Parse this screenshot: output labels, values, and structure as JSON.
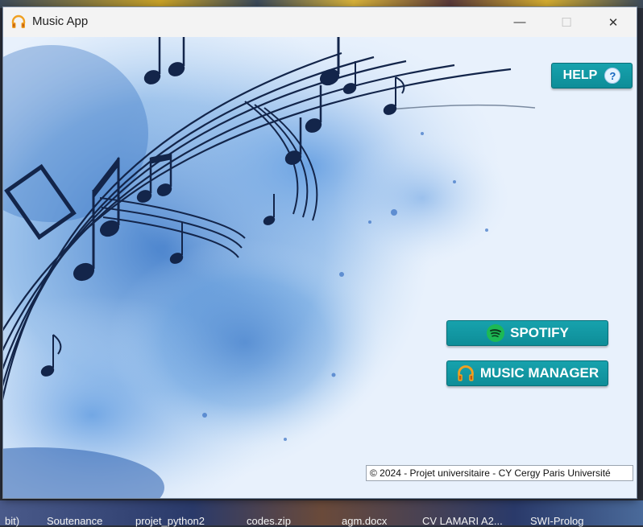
{
  "window": {
    "title": "Music App",
    "controls": {
      "minimize": "—",
      "maximize": "☐",
      "close": "✕"
    }
  },
  "buttons": {
    "help": {
      "label": "HELP",
      "icon": "question-circle-icon"
    },
    "spotify": {
      "label": "SPOTIFY",
      "icon": "spotify-icon"
    },
    "music_manager": {
      "label": "MUSIC MANAGER",
      "icon": "headphones-icon"
    }
  },
  "footer": {
    "copyright": "© 2024 - Projet universitaire - CY Cergy Paris Université"
  },
  "taskbar": {
    "items": [
      "bit)",
      "Soutenance",
      "projet_python2",
      "codes.zip",
      "agm.docx",
      "CV LAMARI A2...",
      "SWI-Prolog"
    ]
  },
  "colors": {
    "button_bg": "#11959f",
    "accent_blue": "#3d7cc9",
    "spotify_green": "#1db954"
  }
}
